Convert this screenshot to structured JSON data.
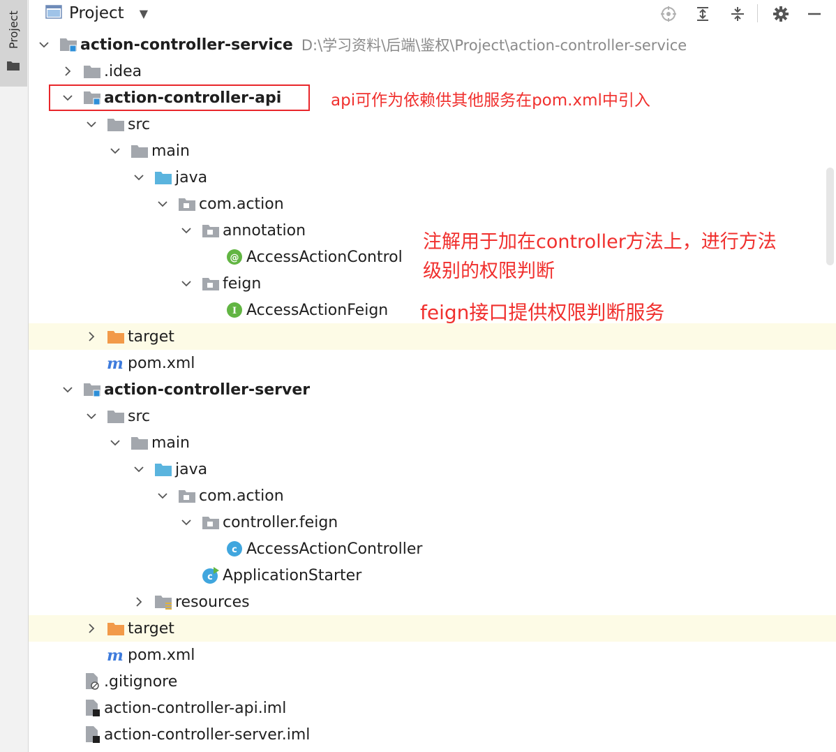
{
  "tool_window": {
    "stripe_label": "Project",
    "title": "Project",
    "toolbar_icons": [
      "locate-icon",
      "expand-all-icon",
      "collapse-all-icon",
      "gear-icon",
      "minimize-icon"
    ]
  },
  "tree": [
    {
      "label": "action-controller-service",
      "path": "D:\\学习资料\\后端\\鉴权\\Project\\action-controller-service",
      "icon": "module-folder-icon",
      "expanded": true
    },
    {
      "label": ".idea",
      "icon": "folder-icon",
      "expanded": false
    },
    {
      "label": "action-controller-api",
      "icon": "module-folder-icon",
      "expanded": true
    },
    {
      "label": "src",
      "icon": "folder-icon",
      "expanded": true
    },
    {
      "label": "main",
      "icon": "folder-icon",
      "expanded": true
    },
    {
      "label": "java",
      "icon": "source-folder-icon",
      "expanded": true
    },
    {
      "label": "com.action",
      "icon": "package-icon",
      "expanded": true
    },
    {
      "label": "annotation",
      "icon": "package-icon",
      "expanded": true
    },
    {
      "label": "AccessActionControl",
      "icon": "annotation-icon"
    },
    {
      "label": "feign",
      "icon": "package-icon",
      "expanded": true
    },
    {
      "label": "AccessActionFeign",
      "icon": "interface-icon"
    },
    {
      "label": "target",
      "icon": "excluded-folder-icon",
      "expanded": false
    },
    {
      "label": "pom.xml",
      "icon": "maven-icon"
    },
    {
      "label": "action-controller-server",
      "icon": "module-folder-icon",
      "expanded": true
    },
    {
      "label": "src",
      "icon": "folder-icon",
      "expanded": true
    },
    {
      "label": "main",
      "icon": "folder-icon",
      "expanded": true
    },
    {
      "label": "java",
      "icon": "source-folder-icon",
      "expanded": true
    },
    {
      "label": "com.action",
      "icon": "package-icon",
      "expanded": true
    },
    {
      "label": "controller.feign",
      "icon": "package-icon",
      "expanded": true
    },
    {
      "label": "AccessActionController",
      "icon": "class-icon"
    },
    {
      "label": "ApplicationStarter",
      "icon": "spring-class-icon"
    },
    {
      "label": "resources",
      "icon": "resources-folder-icon",
      "expanded": false
    },
    {
      "label": "target",
      "icon": "excluded-folder-icon",
      "expanded": false
    },
    {
      "label": "pom.xml",
      "icon": "maven-icon"
    },
    {
      "label": ".gitignore",
      "icon": "ignore-file-icon"
    },
    {
      "label": "action-controller-api.iml",
      "icon": "iml-file-icon"
    },
    {
      "label": "action-controller-server.iml",
      "icon": "iml-file-icon"
    }
  ],
  "annotations": {
    "api_note": "api可作为依赖供其他服务在pom.xml中引入",
    "annotation_note_line1": "注解用于加在controller方法上，进行方法",
    "annotation_note_line2": "级别的权限判断",
    "feign_note": "feign接口提供权限判断服务"
  },
  "colors": {
    "annotation_red": "#f0302e",
    "excluded_row_bg": "#fdfbe6",
    "excluded_folder": "#f29a49",
    "source_folder": "#5ab4de",
    "folder_gray": "#a3a7ad"
  }
}
